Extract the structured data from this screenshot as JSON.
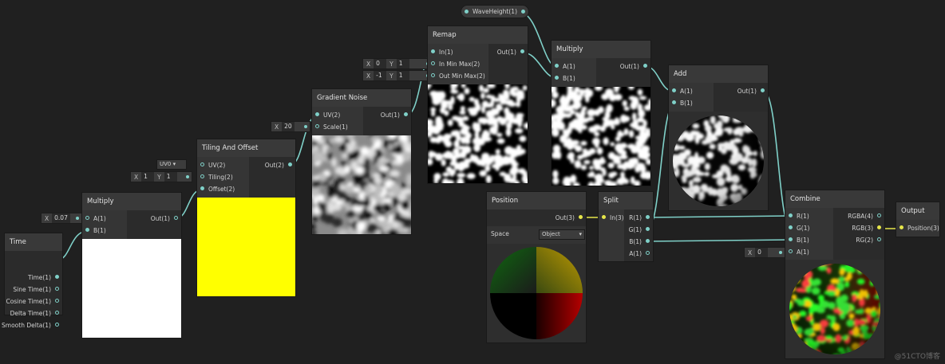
{
  "nodes": {
    "time": {
      "title": "Time",
      "outputs": [
        "Time(1)",
        "Sine Time(1)",
        "Cosine Time(1)",
        "Delta Time(1)",
        "Smooth Delta(1)"
      ]
    },
    "multiply1": {
      "title": "Multiply",
      "inputs": [
        "A(1)",
        "B(1)"
      ],
      "output": "Out(1)",
      "a_axis": "X",
      "a_value": "0.07",
      "preview": "#ffffff"
    },
    "tiling": {
      "title": "Tiling And Offset",
      "inputs": [
        "UV(2)",
        "Tiling(2)",
        "Offset(2)"
      ],
      "output": "Out(2)",
      "uv_select": "UV0",
      "tiling_x": "1",
      "tiling_y": "1",
      "preview": "#ffff00"
    },
    "gradient": {
      "title": "Gradient Noise",
      "inputs": [
        "UV(2)",
        "Scale(1)"
      ],
      "output": "Out(1)",
      "scale_axis": "X",
      "scale_value": "20"
    },
    "remap": {
      "title": "Remap",
      "inputs": [
        "In(1)",
        "In Min Max(2)",
        "Out Min Max(2)"
      ],
      "output": "Out(1)",
      "in_min": "0",
      "in_max": "1",
      "out_min": "-1",
      "out_max": "1"
    },
    "wave": {
      "label": "WaveHeight(1)"
    },
    "multiply2": {
      "title": "Multiply",
      "inputs": [
        "A(1)",
        "B(1)"
      ],
      "output": "Out(1)"
    },
    "add": {
      "title": "Add",
      "inputs": [
        "A(1)",
        "B(1)"
      ],
      "output": "Out(1)"
    },
    "position": {
      "title": "Position",
      "output": "Out(3)",
      "space_label": "Space",
      "space_value": "Object"
    },
    "split": {
      "title": "Split",
      "input": "In(3)",
      "outputs": [
        "R(1)",
        "G(1)",
        "B(1)",
        "A(1)"
      ]
    },
    "combine": {
      "title": "Combine",
      "inputs": [
        "R(1)",
        "G(1)",
        "B(1)",
        "A(1)"
      ],
      "outputs": [
        "RGBA(4)",
        "RGB(3)",
        "RG(2)"
      ],
      "a_axis": "X",
      "a_value": "0"
    },
    "output": {
      "title": "Output",
      "input": "Position(3)"
    }
  },
  "axis_labels": {
    "x": "X",
    "y": "Y"
  },
  "watermark": "@51CTO博客",
  "colors": {
    "wire": "#7fd0c8",
    "wire_yellow": "#e6e64a",
    "canvas": "#202020",
    "node": "#2b2b2b",
    "header": "#393939"
  }
}
